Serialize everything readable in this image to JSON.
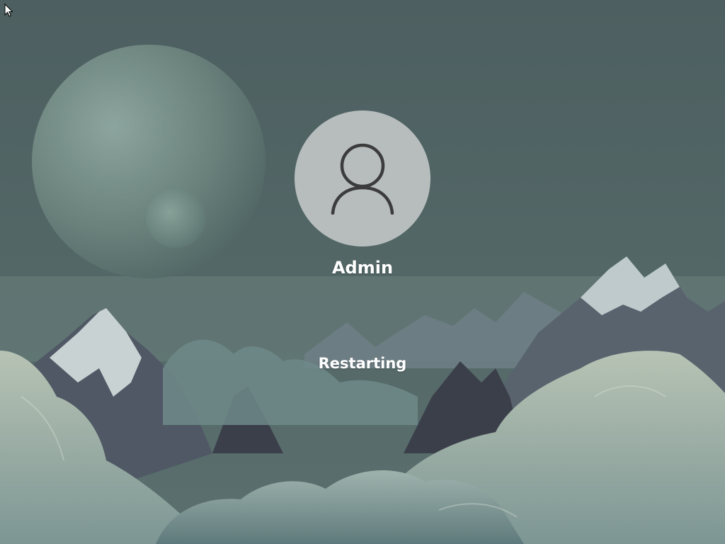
{
  "user": {
    "name": "Admin",
    "avatar_icon": "user-silhouette-icon"
  },
  "status": {
    "text": "Restarting"
  },
  "pointer": {
    "icon": "mouse-pointer-icon"
  },
  "colors": {
    "sky": "#4f6263",
    "avatar_circle": "#b7bdbd",
    "avatar_icon_stroke": "#3c3c3c",
    "text": "#ffffff"
  }
}
